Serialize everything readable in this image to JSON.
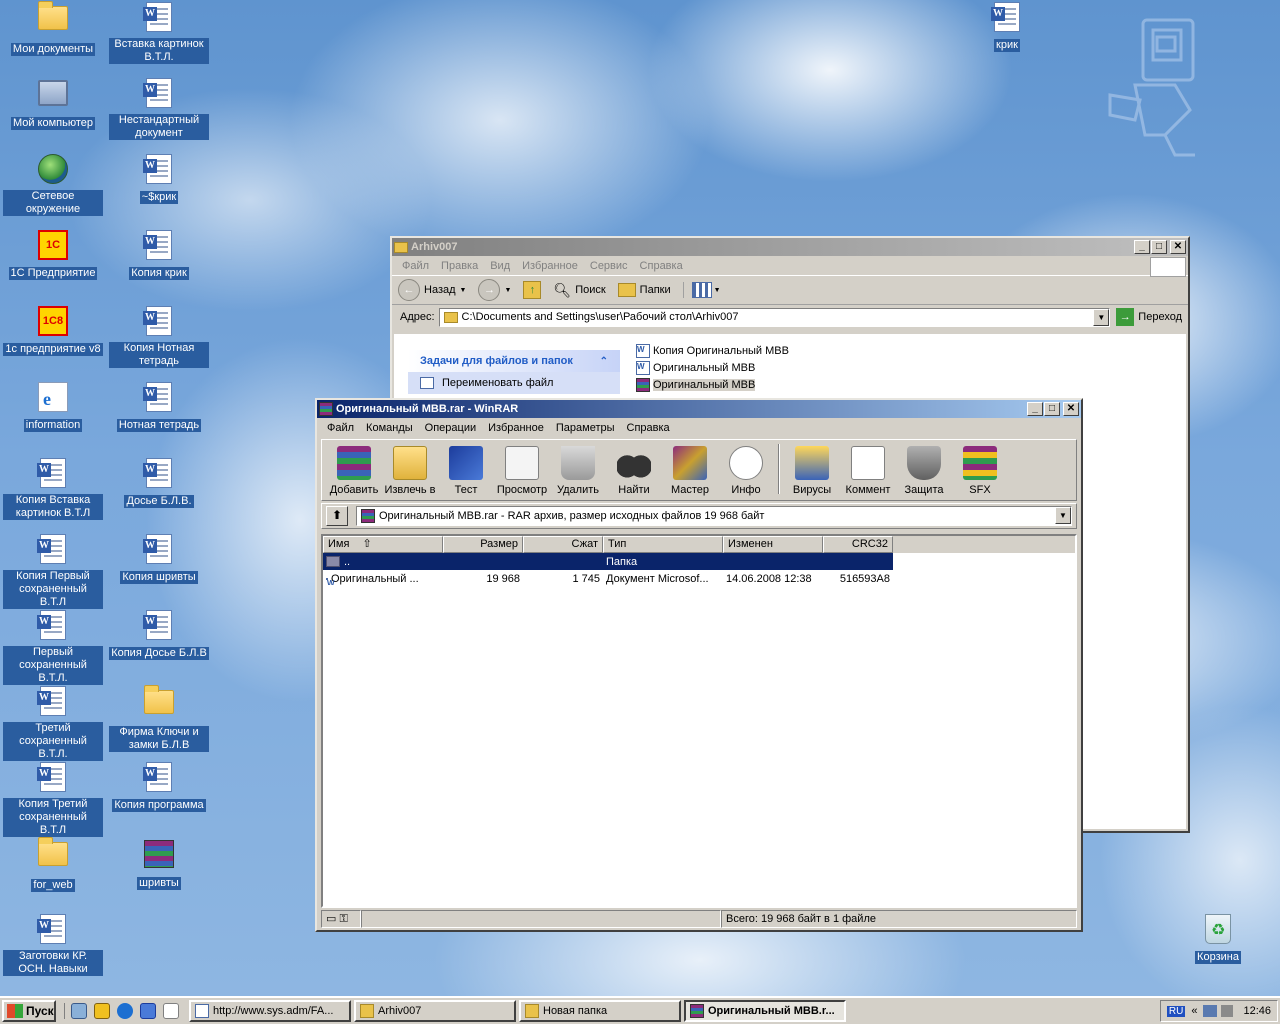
{
  "desktop": {
    "icons_col1": [
      {
        "label": "Мои документы",
        "icon": "folder-docs"
      },
      {
        "label": "Мой компьютер",
        "icon": "computer"
      },
      {
        "label": "Сетевое окружение",
        "icon": "network"
      },
      {
        "label": "1С Предприятие",
        "icon": "onec"
      },
      {
        "label": "1с предприятие v8",
        "icon": "onec8"
      },
      {
        "label": "information",
        "icon": "ie-shortcut"
      },
      {
        "label": "Копия Вставка картинок В.Т.Л",
        "icon": "word-doc"
      },
      {
        "label": "Копия Первый сохраненный В.Т.Л",
        "icon": "word-doc"
      },
      {
        "label": "Первый сохраненный В.Т.Л.",
        "icon": "word-doc"
      },
      {
        "label": "Третий сохраненный В.Т.Л.",
        "icon": "word-doc"
      },
      {
        "label": "Копия Третий сохраненный В.Т.Л",
        "icon": "word-doc"
      },
      {
        "label": "for_web",
        "icon": "folder"
      },
      {
        "label": "Заготовки КР. ОСН. Навыки",
        "icon": "word-doc"
      }
    ],
    "icons_col2": [
      {
        "label": "Вставка картинок В.Т.Л.",
        "icon": "word-doc"
      },
      {
        "label": "Нестандартный документ",
        "icon": "word-doc"
      },
      {
        "label": "~$крик",
        "icon": "word-doc"
      },
      {
        "label": "Копия крик",
        "icon": "word-doc"
      },
      {
        "label": "Копия Нотная тетрадь",
        "icon": "word-doc"
      },
      {
        "label": "Нотная тетрадь",
        "icon": "word-doc"
      },
      {
        "label": "Досье Б.Л.В.",
        "icon": "word-doc"
      },
      {
        "label": "Копия шривты",
        "icon": "word-doc"
      },
      {
        "label": "Копия Досье Б.Л.В",
        "icon": "word-doc"
      },
      {
        "label": "Фирма Ключи и замки Б.Л.В",
        "icon": "folder"
      },
      {
        "label": "Копия программа",
        "icon": "word-doc"
      },
      {
        "label": "шривты",
        "icon": "rar-archive"
      }
    ],
    "icon_krik": {
      "label": "крик",
      "icon": "word-doc"
    },
    "icon_trash": {
      "label": "Корзина",
      "icon": "recycle-bin"
    }
  },
  "explorer": {
    "title": "Arhiv007",
    "menu": [
      "Файл",
      "Правка",
      "Вид",
      "Избранное",
      "Сервис",
      "Справка"
    ],
    "toolbar": {
      "back": "Назад",
      "search": "Поиск",
      "folders": "Папки"
    },
    "address_label": "Адрес:",
    "address": "C:\\Documents and Settings\\user\\Рабочий стол\\Arhiv007",
    "go": "Переход",
    "task_header": "Задачи для файлов и папок",
    "task_item": "Переименовать файл",
    "files": [
      {
        "name": "Копия Оригинальный МВВ",
        "icon": "word-doc"
      },
      {
        "name": "Оригинальный МВВ",
        "icon": "word-doc"
      },
      {
        "name": "Оригинальный МВВ",
        "icon": "rar-archive"
      }
    ]
  },
  "winrar": {
    "title": "Оригинальный МВВ.rar - WinRAR",
    "menu": [
      "Файл",
      "Команды",
      "Операции",
      "Избранное",
      "Параметры",
      "Справка"
    ],
    "toolbar": [
      "Добавить",
      "Извлечь в",
      "Тест",
      "Просмотр",
      "Удалить",
      "Найти",
      "Мастер",
      "Инфо",
      "Вирусы",
      "Коммент",
      "Защита",
      "SFX"
    ],
    "path": "Оригинальный МВВ.rar - RAR архив, размер исходных файлов 19 968 байт",
    "columns": [
      "Имя",
      "Размер",
      "Сжат",
      "Тип",
      "Изменен",
      "CRC32"
    ],
    "rows": [
      {
        "name": "..",
        "size": "",
        "packed": "",
        "type": "Папка",
        "modified": "",
        "crc": ""
      },
      {
        "name": "Оригинальный ...",
        "size": "19 968",
        "packed": "1 745",
        "type": "Документ Microsof...",
        "modified": "14.06.2008 12:38",
        "crc": "516593A8"
      }
    ],
    "status": "Всего: 19 968 байт в 1 файле"
  },
  "taskbar": {
    "start": "Пуск",
    "tasks": [
      {
        "label": "http://www.sys.adm/FA...",
        "active": false
      },
      {
        "label": "Arhiv007",
        "active": false
      },
      {
        "label": "Новая папка",
        "active": false
      },
      {
        "label": "Оригинальный MBB.r...",
        "active": true
      }
    ],
    "lang": "RU",
    "clock": "12:46"
  },
  "colors": {
    "titlebar_active": "#0a246a",
    "desktop_label_bg": "#2a5d9f",
    "selection": "#0a246a"
  }
}
